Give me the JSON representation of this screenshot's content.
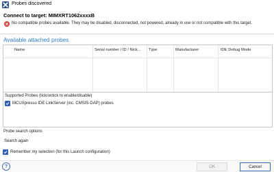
{
  "window": {
    "title": "Probes discovered",
    "app_icon": "x-icon"
  },
  "header": {
    "connect_title": "Connect to target: MIMXRT1062xxxxB",
    "error_icon": "error-icon",
    "error_text": "No compatible probes available. They may be disabled, disconnected, not powered, already in use or not compatible with this target."
  },
  "probes_table": {
    "section_title": "Available attached probes",
    "columns": [
      "Name",
      "Serial number / ID / Nick...",
      "Type",
      "Manufacturer",
      "IDE Debug Mode"
    ],
    "rows": []
  },
  "supported_probes": {
    "group_title": "Supported Probes (tick/untick to enable/disable)",
    "items": [
      {
        "label": "MCUXpresso IDE LinkServer (inc. CMSIS-DAP) probes",
        "checked": true
      }
    ]
  },
  "search": {
    "group_title": "Probe search options",
    "button_label": "Search again"
  },
  "remember": {
    "label": "Remember my selection (for this Launch configuration)",
    "checked": true
  },
  "footer": {
    "help_icon": "help-icon",
    "ok_label": "OK",
    "cancel_label": "Cancel"
  },
  "colors": {
    "accent": "#2d7cc6",
    "error": "#d63b3b",
    "checkbox": "#2f5fb5"
  }
}
